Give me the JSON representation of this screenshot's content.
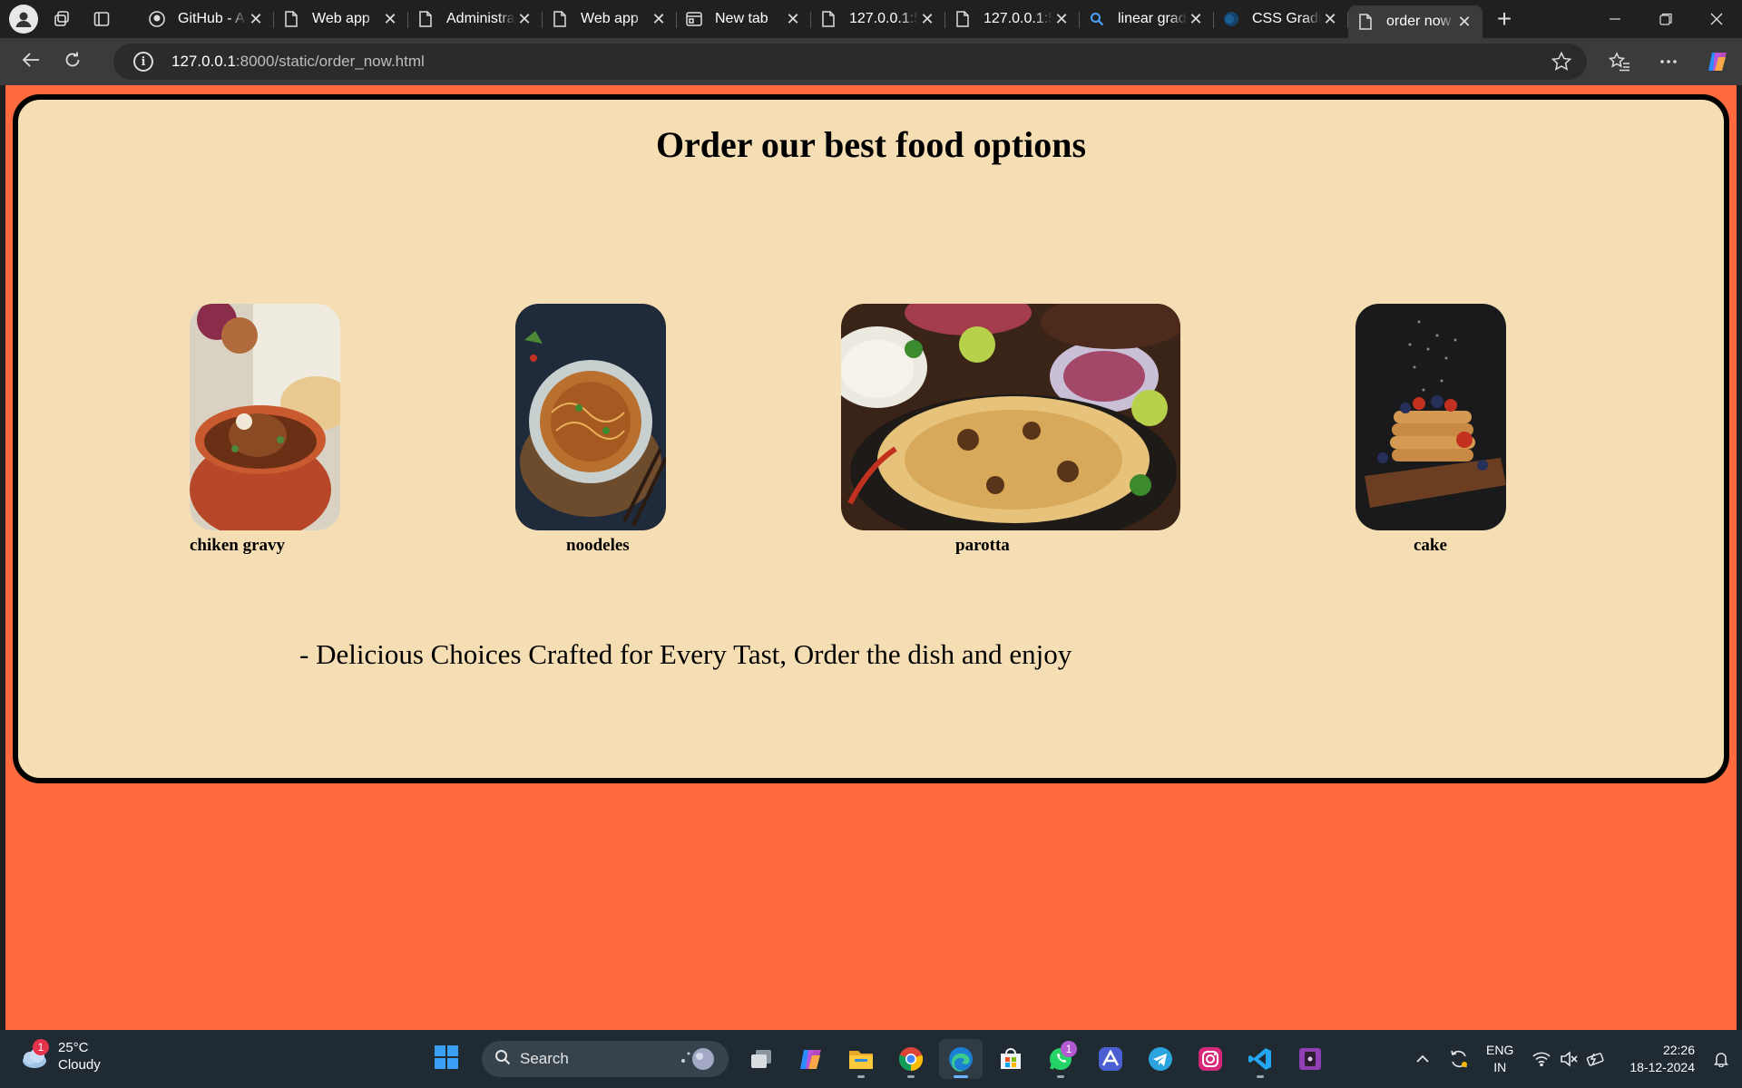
{
  "browser": {
    "tabs": [
      {
        "label": "GitHub - A",
        "icon": "github-icon",
        "active": false
      },
      {
        "label": "Web app",
        "icon": "page-icon",
        "active": false
      },
      {
        "label": "Administra",
        "icon": "page-icon",
        "active": false
      },
      {
        "label": "Web app",
        "icon": "page-icon",
        "active": false
      },
      {
        "label": "New tab",
        "icon": "newtab-icon",
        "active": false
      },
      {
        "label": "127.0.0.1:5",
        "icon": "page-icon",
        "active": false
      },
      {
        "label": "127.0.0.1:5",
        "icon": "page-icon",
        "active": false
      },
      {
        "label": "linear grad",
        "icon": "search-icon",
        "active": false
      },
      {
        "label": "CSS Gradie",
        "icon": "globe-icon",
        "active": false
      },
      {
        "label": "order now",
        "icon": "page-icon",
        "active": true
      }
    ],
    "address": {
      "host": "127.0.0.1",
      "path": ":8000/static/order_now.html"
    }
  },
  "page": {
    "title": "Order our best food options",
    "items": [
      {
        "caption": "chiken gravy"
      },
      {
        "caption": "noodeles"
      },
      {
        "caption": "parotta"
      },
      {
        "caption": "cake"
      }
    ],
    "tagline": "- Delicious Choices Crafted for Every Tast, Order the dish and enjoy",
    "colors": {
      "page_bg": "#ff6b3d",
      "card_bg": "#f5deb3",
      "card_border": "#000000"
    }
  },
  "taskbar": {
    "weather": {
      "temp": "25°C",
      "condition": "Cloudy",
      "badge": "1"
    },
    "search_label": "Search",
    "apps": [
      {
        "name": "task-view-icon"
      },
      {
        "name": "copilot-icon"
      },
      {
        "name": "file-explorer-icon"
      },
      {
        "name": "chrome-icon"
      },
      {
        "name": "edge-icon",
        "active": true
      },
      {
        "name": "store-icon"
      },
      {
        "name": "whatsapp-icon",
        "badge": "1"
      },
      {
        "name": "arc-icon"
      },
      {
        "name": "telegram-icon"
      },
      {
        "name": "instagram-icon"
      },
      {
        "name": "vscode-icon"
      },
      {
        "name": "app-icon"
      }
    ],
    "lang": {
      "line1": "ENG",
      "line2": "IN"
    },
    "clock": {
      "time": "22:26",
      "date": "18-12-2024"
    }
  }
}
